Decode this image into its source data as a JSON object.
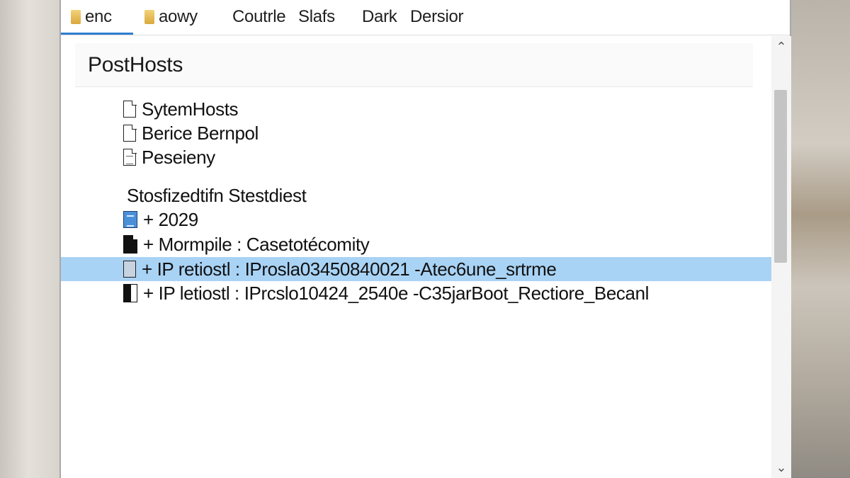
{
  "tabs": [
    {
      "label": "enc",
      "icon": "folder-icon",
      "active": true
    },
    {
      "label": "aowy",
      "icon": "folder-icon",
      "active": false
    },
    {
      "label": "Coutrle"
    },
    {
      "label": "Slafs"
    },
    {
      "label": "Dark"
    },
    {
      "label": "Dersior"
    }
  ],
  "main": {
    "title": "PostHosts",
    "files": [
      {
        "label": "SytemHosts",
        "icon": "document-icon"
      },
      {
        "label": "Berice Bernpol",
        "icon": "document-icon"
      },
      {
        "label": "Peseieny",
        "icon": "document-lines-icon"
      }
    ],
    "section_title": "Stosfizedtifn Stestdiest",
    "entries": [
      {
        "label": "+ 2029",
        "icon": "blue-document-icon"
      },
      {
        "label": "+ Mormpile : Casetotécomity",
        "icon": "black-document-icon"
      },
      {
        "label": "+ IP retiostl : IProsla03450840021 -Atec6une_srtrme",
        "icon": "grey-document-icon",
        "selected": true
      },
      {
        "label": "+ IP letiostl : IPrcslo10424_2540e -C35jarBoot_Rectiore_Becanl",
        "icon": "half-black-document-icon"
      }
    ]
  },
  "scrollbar": {
    "up_glyph": "⌃",
    "down_glyph": "⌄"
  },
  "colors": {
    "selection": "#a9d3f5",
    "tab_accent": "#2f7fd1"
  }
}
